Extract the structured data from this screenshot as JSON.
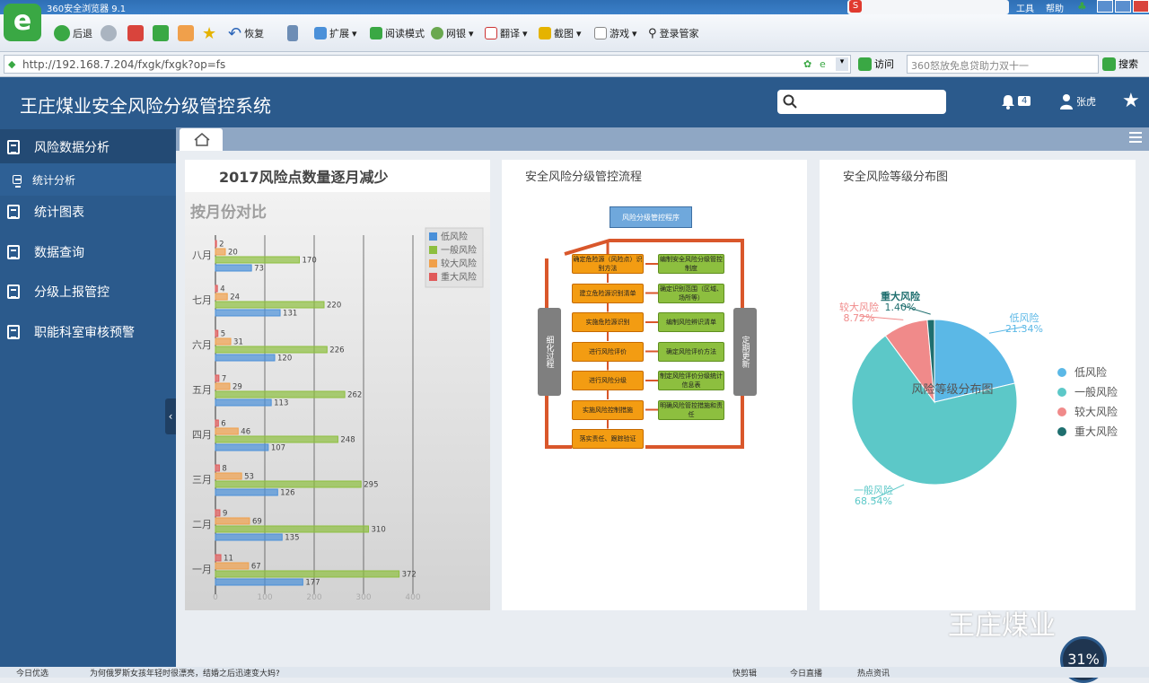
{
  "browser": {
    "title": "360安全浏览器 9.1",
    "back": "后退",
    "restore": "恢复",
    "extend": "扩展",
    "reading_mode": "阅读模式",
    "bank": "网银",
    "translate": "翻译",
    "screenshot": "截图",
    "games": "游戏",
    "login": "登录管家",
    "url": "http://192.168.7.204/fxgk/fxgk?op=fs",
    "go": "访问",
    "search_placeholder": "360怒放免息贷助力双十一",
    "search_btn": "搜索",
    "tools": "工具",
    "help": "帮助"
  },
  "app": {
    "title": "王庄煤业安全风险分级管控系统",
    "notif_count": "4",
    "user": "张虎"
  },
  "sidebar": {
    "items": [
      {
        "label": "风险数据分析"
      },
      {
        "label": "统计分析"
      },
      {
        "label": "统计图表"
      },
      {
        "label": "数据查询"
      },
      {
        "label": "分级上报管控"
      },
      {
        "label": "职能科室审核预警"
      }
    ]
  },
  "panels": {
    "left_title": "2017风险点数量逐月减少",
    "left_subtitle": "按月份对比",
    "mid_title": "安全风险分级管控流程",
    "right_title": "安全风险等级分布图"
  },
  "colors": {
    "low": "#4a90d9",
    "general": "#8dbf3f",
    "higher": "#f0a04b",
    "major": "#e05a5a"
  },
  "chart_data": [
    {
      "type": "bar",
      "orientation": "horizontal",
      "title": "按月份对比",
      "categories": [
        "八月",
        "七月",
        "六月",
        "五月",
        "四月",
        "三月",
        "二月",
        "一月"
      ],
      "series": [
        {
          "name": "低风险",
          "values": [
            73,
            131,
            120,
            113,
            107,
            126,
            135,
            177
          ]
        },
        {
          "name": "一般风险",
          "values": [
            170,
            220,
            226,
            262,
            248,
            295,
            310,
            372
          ]
        },
        {
          "name": "较大风险",
          "values": [
            20,
            24,
            31,
            29,
            46,
            53,
            69,
            67
          ]
        },
        {
          "name": "重大风险",
          "values": [
            2,
            4,
            5,
            7,
            6,
            8,
            9,
            11
          ]
        }
      ],
      "xlim": [
        0,
        400
      ],
      "xticks": [
        "0",
        "100",
        "200",
        "300",
        "400"
      ],
      "legend": "top-right",
      "grid": true
    },
    {
      "type": "pie",
      "title": "风险等级分布图",
      "labels": [
        "低风险",
        "一般风险",
        "较大风险",
        "重大风险"
      ],
      "values": [
        21.34,
        68.54,
        8.72,
        1.4
      ],
      "value_labels": [
        "21.34%",
        "68.54%",
        "8.72%",
        "1.40%"
      ],
      "legend": "right"
    }
  ],
  "flow": {
    "head": "风险分级管控程序",
    "steps": [
      "确定危险源（风险点）识别方法",
      "建立危险源识别清单",
      "实施危险源识别",
      "进行风险评价",
      "进行风险分级",
      "实施风险控制措施",
      "落实责任、跟踪验证"
    ],
    "notes": [
      "编制安全风险分级管控制度",
      "确定识别范围（区域、场所等）",
      "编制风险辨识清单",
      "确定风险评价方法",
      "制定风险评价分级统计信息表",
      "明确风险管控措施和责任",
      ""
    ],
    "left_bar": "细化过程",
    "right_bar": "定期更新"
  },
  "watermark": {
    "text": "王庄煤业",
    "percent": "31%"
  },
  "statusbar": {
    "left": "今日优选",
    "news": "为何俄罗斯女孩年轻时很漂亮，结婚之后迅速变大妈?",
    "r1": "快剪辑",
    "r2": "今日直播",
    "r3": "热点资讯"
  }
}
